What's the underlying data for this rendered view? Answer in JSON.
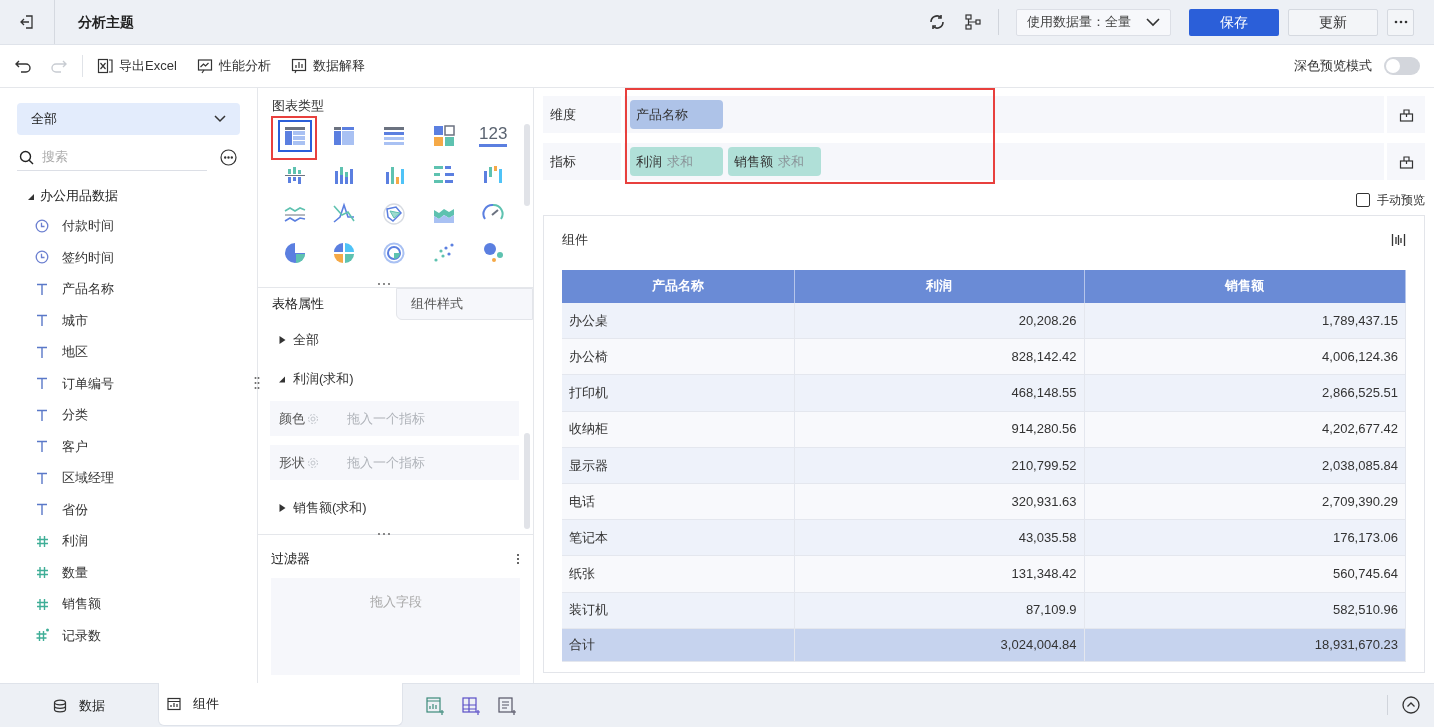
{
  "header": {
    "title": "分析主题",
    "data_amount": "使用数据量：全量",
    "buttons": [
      {
        "label": "保存",
        "kind": "primary"
      },
      {
        "label": "更新",
        "kind": "default"
      }
    ]
  },
  "toolbar": {
    "redo_disabled": true,
    "items": [
      {
        "label": "导出Excel",
        "kind": "excel"
      },
      {
        "label": "性能分析",
        "kind": "perf"
      },
      {
        "label": "数据解释",
        "kind": "explain"
      }
    ],
    "dark_preview": {
      "label": "深色预览模式",
      "on": false
    }
  },
  "field_panel": {
    "scope": "全部",
    "search_placeholder": "搜索",
    "dataset": {
      "name": "办公用品数据",
      "expanded": true,
      "fields": [
        {
          "name": "付款时间",
          "kind": "time"
        },
        {
          "name": "签约时间",
          "kind": "time"
        },
        {
          "name": "产品名称",
          "kind": "text"
        },
        {
          "name": "城市",
          "kind": "text"
        },
        {
          "name": "地区",
          "kind": "text"
        },
        {
          "name": "订单编号",
          "kind": "text"
        },
        {
          "name": "分类",
          "kind": "text"
        },
        {
          "name": "客户",
          "kind": "text"
        },
        {
          "name": "区域经理",
          "kind": "text"
        },
        {
          "name": "省份",
          "kind": "text"
        },
        {
          "name": "利润",
          "kind": "number"
        },
        {
          "name": "数量",
          "kind": "number"
        },
        {
          "name": "销售额",
          "kind": "number"
        },
        {
          "name": "记录数",
          "kind": "count"
        }
      ]
    }
  },
  "chart_types": {
    "title": "图表类型",
    "items": [
      {
        "kind": "table",
        "selected": true
      },
      {
        "kind": "crosstab",
        "selected": false
      },
      {
        "kind": "detail",
        "selected": false
      },
      {
        "kind": "tiles",
        "selected": false
      },
      {
        "kind": "kpi",
        "glyph": "123",
        "selected": false
      },
      {
        "kind": "bar1",
        "selected": false
      },
      {
        "kind": "bar2",
        "selected": false
      },
      {
        "kind": "bar3",
        "selected": false
      },
      {
        "kind": "hbar",
        "selected": false
      },
      {
        "kind": "bar4",
        "selected": false
      },
      {
        "kind": "line1",
        "selected": false
      },
      {
        "kind": "line2",
        "selected": false
      },
      {
        "kind": "radar",
        "selected": false
      },
      {
        "kind": "area",
        "selected": false
      },
      {
        "kind": "gauge",
        "selected": false
      },
      {
        "kind": "pie1",
        "selected": false
      },
      {
        "kind": "pie2",
        "selected": false
      },
      {
        "kind": "donut",
        "selected": false
      },
      {
        "kind": "scatter",
        "selected": false
      },
      {
        "kind": "bubble",
        "selected": false
      }
    ]
  },
  "properties": {
    "tabs": [
      {
        "label": "表格属性",
        "selected": true
      },
      {
        "label": "组件样式",
        "selected": false
      }
    ],
    "sections": [
      {
        "label": "全部",
        "expanded": false
      },
      {
        "label": "利润(求和)",
        "expanded": true,
        "slots": [
          {
            "label": "颜色",
            "placeholder": "拖入一个指标"
          },
          {
            "label": "形状",
            "placeholder": "拖入一个指标"
          }
        ]
      },
      {
        "label": "销售额(求和)",
        "expanded": false
      }
    ]
  },
  "filter": {
    "title": "过滤器",
    "placeholder": "拖入字段"
  },
  "shelves": [
    {
      "label": "维度",
      "pills": [
        {
          "name": "产品名称",
          "kind": "dimension"
        }
      ]
    },
    {
      "label": "指标",
      "pills": [
        {
          "name": "利润",
          "aggregation": "求和",
          "kind": "measure"
        },
        {
          "name": "销售额",
          "aggregation": "求和",
          "kind": "measure"
        }
      ]
    }
  ],
  "manual_preview": {
    "label": "手动预览",
    "checked": false
  },
  "component": {
    "title": "组件",
    "table": {
      "columns": [
        "产品名称",
        "利润",
        "销售额"
      ],
      "rows": [
        [
          "办公桌",
          "20,208.26",
          "1,789,437.15"
        ],
        [
          "办公椅",
          "828,142.42",
          "4,006,124.36"
        ],
        [
          "打印机",
          "468,148.55",
          "2,866,525.51"
        ],
        [
          "收纳柜",
          "914,280.56",
          "4,202,677.42"
        ],
        [
          "显示器",
          "210,799.52",
          "2,038,085.84"
        ],
        [
          "电话",
          "320,931.63",
          "2,709,390.29"
        ],
        [
          "笔记本",
          "43,035.58",
          "176,173.06"
        ],
        [
          "纸张",
          "131,348.42",
          "560,745.64"
        ],
        [
          "装订机",
          "87,109.9",
          "582,510.96"
        ]
      ],
      "total": [
        "合计",
        "3,024,004.84",
        "18,931,670.23"
      ]
    }
  },
  "bottom_tabs": [
    {
      "label": "数据",
      "kind": "data",
      "selected": false
    },
    {
      "label": "组件",
      "kind": "component",
      "selected": true
    }
  ]
}
